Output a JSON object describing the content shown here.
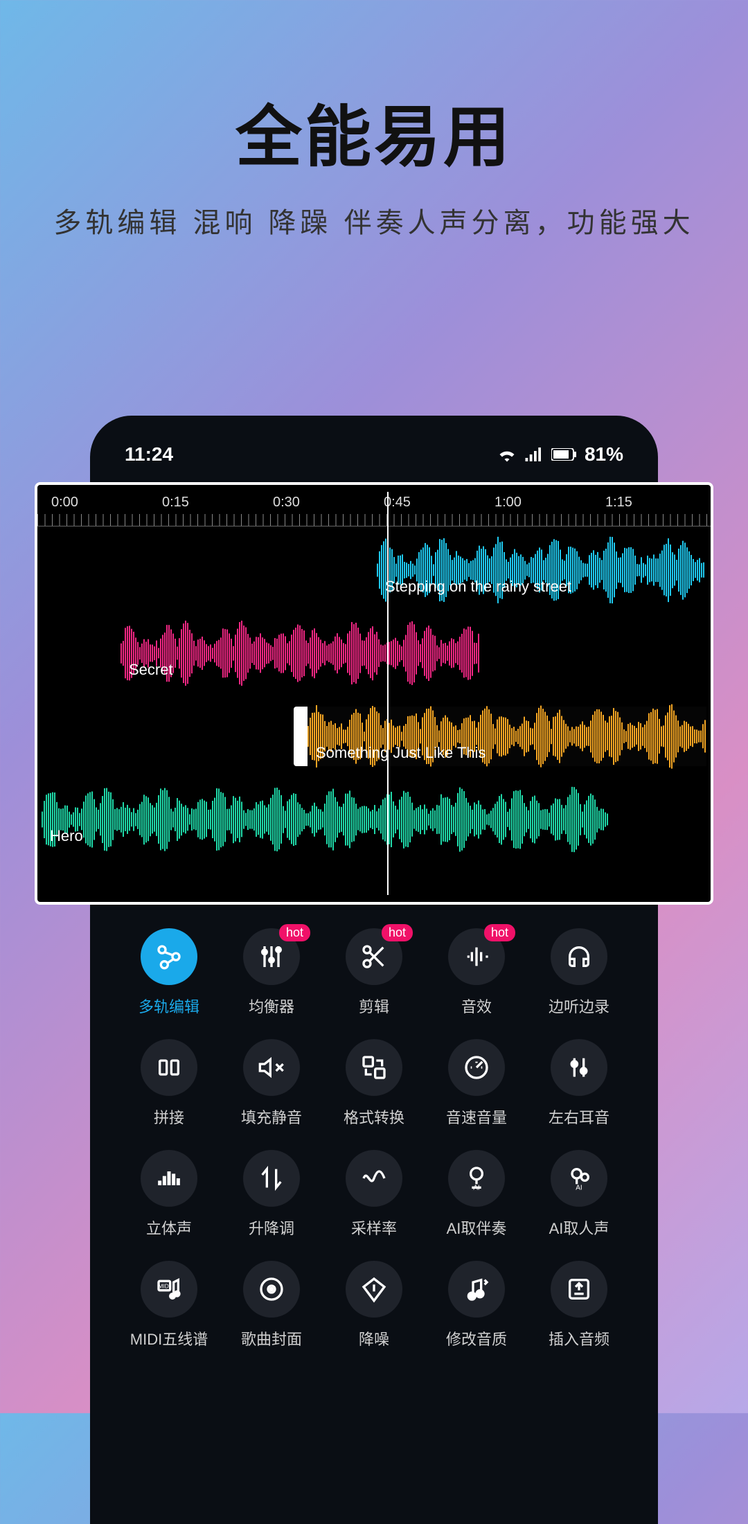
{
  "hero": {
    "title": "全能易用",
    "subtitle": "多轨编辑  混响  降躁  伴奏人声分离，功能强大"
  },
  "status": {
    "time": "11:24",
    "battery": "81%"
  },
  "timeline": {
    "labels": [
      "0:00",
      "0:15",
      "0:30",
      "0:45",
      "1:00",
      "1:15"
    ],
    "playhead_pos": "0:45",
    "tracks": [
      {
        "name": "Stepping on the rainy street",
        "color": "#1fc9ef"
      },
      {
        "name": "Secret",
        "color": "#ef2783"
      },
      {
        "name": "Something Just Like This",
        "color": "#f5a623"
      },
      {
        "name": "Hero",
        "color": "#1fd8a8"
      }
    ]
  },
  "tools": [
    {
      "label": "多轨编辑",
      "icon": "multitrack",
      "active": true,
      "hot": false
    },
    {
      "label": "均衡器",
      "icon": "equalizer",
      "active": false,
      "hot": true
    },
    {
      "label": "剪辑",
      "icon": "scissors",
      "active": false,
      "hot": true
    },
    {
      "label": "音效",
      "icon": "soundfx",
      "active": false,
      "hot": true
    },
    {
      "label": "边听边录",
      "icon": "headphones",
      "active": false,
      "hot": false
    },
    {
      "label": "拼接",
      "icon": "splice",
      "active": false,
      "hot": false
    },
    {
      "label": "填充静音",
      "icon": "mute",
      "active": false,
      "hot": false
    },
    {
      "label": "格式转换",
      "icon": "convert",
      "active": false,
      "hot": false
    },
    {
      "label": "音速音量",
      "icon": "gauge",
      "active": false,
      "hot": false
    },
    {
      "label": "左右耳音",
      "icon": "stereo",
      "active": false,
      "hot": false
    },
    {
      "label": "立体声",
      "icon": "bars",
      "active": false,
      "hot": false
    },
    {
      "label": "升降调",
      "icon": "pitch",
      "active": false,
      "hot": false
    },
    {
      "label": "采样率",
      "icon": "sample",
      "active": false,
      "hot": false
    },
    {
      "label": "AI取伴奏",
      "icon": "aimic",
      "active": false,
      "hot": false
    },
    {
      "label": "AI取人声",
      "icon": "aivocal",
      "active": false,
      "hot": false
    },
    {
      "label": "MIDI五线谱",
      "icon": "midi",
      "active": false,
      "hot": false
    },
    {
      "label": "歌曲封面",
      "icon": "cover",
      "active": false,
      "hot": false
    },
    {
      "label": "降噪",
      "icon": "denoise",
      "active": false,
      "hot": false
    },
    {
      "label": "修改音质",
      "icon": "quality",
      "active": false,
      "hot": false
    },
    {
      "label": "插入音频",
      "icon": "insert",
      "active": false,
      "hot": false
    }
  ],
  "hot_label": "hot"
}
